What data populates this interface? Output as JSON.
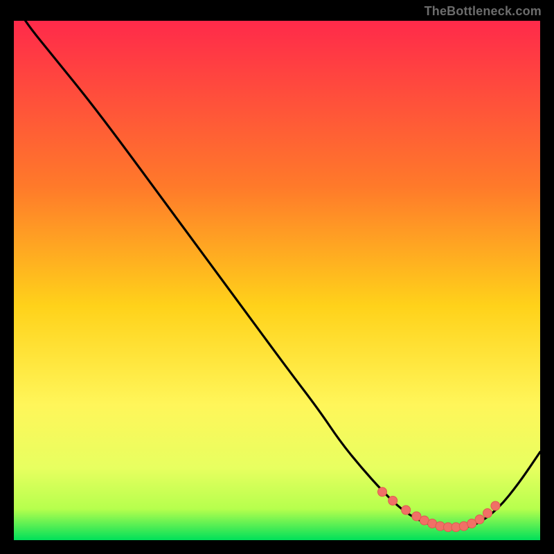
{
  "watermark": "TheBottleneck.com",
  "colors": {
    "bg_black": "#000000",
    "curve": "#000000",
    "marker": "#f07066",
    "marker_stroke": "#e05a50",
    "grad_top": "#ff2a4a",
    "grad_mid1": "#ff7a2a",
    "grad_mid2": "#ffd21a",
    "grad_mid3": "#fff65a",
    "grad_mid4": "#e8ff60",
    "grad_mid5": "#b6ff4d",
    "grad_bottom": "#00e05a"
  },
  "chart_data": {
    "type": "line",
    "title": "",
    "xlabel": "",
    "ylabel": "",
    "xlim": [
      0,
      100
    ],
    "ylim": [
      0,
      100
    ],
    "series": [
      {
        "name": "bottleneck-curve",
        "x": [
          0,
          2,
          8,
          14,
          20,
          28,
          36,
          44,
          52,
          58,
          62,
          66,
          70,
          73,
          76,
          79,
          82,
          85,
          88,
          92,
          96,
          100
        ],
        "y": [
          104,
          100,
          92.5,
          85,
          77,
          66,
          55,
          44,
          33,
          25,
          19,
          14,
          9.5,
          6.5,
          4.3,
          3.0,
          2.3,
          2.3,
          3.0,
          6.0,
          11.0,
          17.0
        ]
      }
    ],
    "markers": {
      "name": "highlight-points",
      "x": [
        70,
        72,
        74.5,
        76.5,
        78,
        79.5,
        81,
        82.5,
        84,
        85.5,
        87,
        88.5,
        90,
        91.5
      ],
      "y": [
        9.3,
        7.6,
        5.8,
        4.6,
        3.8,
        3.2,
        2.7,
        2.5,
        2.5,
        2.7,
        3.2,
        4.0,
        5.2,
        6.6
      ]
    }
  }
}
